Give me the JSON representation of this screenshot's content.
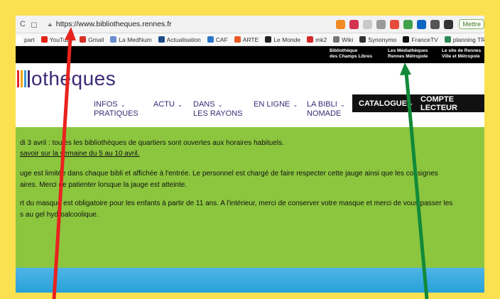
{
  "browser": {
    "url": "https://www.bibliotheques.rennes.fr",
    "extension_button": "Mettre"
  },
  "bookmarks": [
    {
      "label": "part",
      "color": "#ffffff"
    },
    {
      "label": "YouTube",
      "color": "#e62117"
    },
    {
      "label": "Gmail",
      "color": "#d93025"
    },
    {
      "label": "La MedNum",
      "color": "#6a8fd1"
    },
    {
      "label": "Actualisation",
      "color": "#1d4e89"
    },
    {
      "label": "CAF",
      "color": "#2a77c9"
    },
    {
      "label": "ARTE",
      "color": "#e85a25"
    },
    {
      "label": "Le Monde",
      "color": "#222222"
    },
    {
      "label": "mk2",
      "color": "#d42a2a"
    },
    {
      "label": "Wiki",
      "color": "#777777"
    },
    {
      "label": "Synonymo",
      "color": "#333333"
    },
    {
      "label": "FranceTV",
      "color": "#111111"
    },
    {
      "label": "planning TRI \"lib",
      "color": "#2e8b57"
    }
  ],
  "top_links": [
    {
      "line1": "Bibliothèque",
      "line2": "des Champs Libres"
    },
    {
      "line1": "Les Médiathèques",
      "line2": "Rennes Métropole"
    },
    {
      "line1": "Le site de Rennes",
      "line2": "Ville et Métropole"
    }
  ],
  "site": {
    "logo_text": "otheques"
  },
  "nav": [
    {
      "line1": "INFOS",
      "line2": "PRATIQUES"
    },
    {
      "line1": "ACTU",
      "line2": ""
    },
    {
      "line1": "DANS",
      "line2": "LES RAYONS"
    },
    {
      "line1": "EN LIGNE",
      "line2": ""
    },
    {
      "line1": "LA BIBLI",
      "line2": "NOMADE"
    },
    {
      "line1": "CATALOGUE",
      "line2": ""
    },
    {
      "line1": "COMPTE LECTEUR",
      "line2": ""
    }
  ],
  "info": {
    "line1": "di 3 avril : toutes les bibliothèques de quartiers sont ouvertes aux horaires habituels.",
    "line2": "savoir sur la semaine du 5 au 10 avril.",
    "line3": "uge est limitée dans chaque bibli et affichée à l'entrée. Le personnel est chargé de faire respecter cette jauge ainsi que les consignes",
    "line4": "aires. Merci de patienter lorsque la jauge est atteinte.",
    "line5": "rt du masque est obligatoire pour les enfants à partir de 11 ans. A l'intérieur, merci de conserver votre masque et merci de vous passer les",
    "line6": "s au gel hydroalcoolique."
  },
  "colors": {
    "background": "#fbe04f",
    "info_panel": "#8cc63f",
    "brand_purple": "#3c2a74",
    "arrow_red": "#e8231f",
    "arrow_green": "#128a38"
  }
}
